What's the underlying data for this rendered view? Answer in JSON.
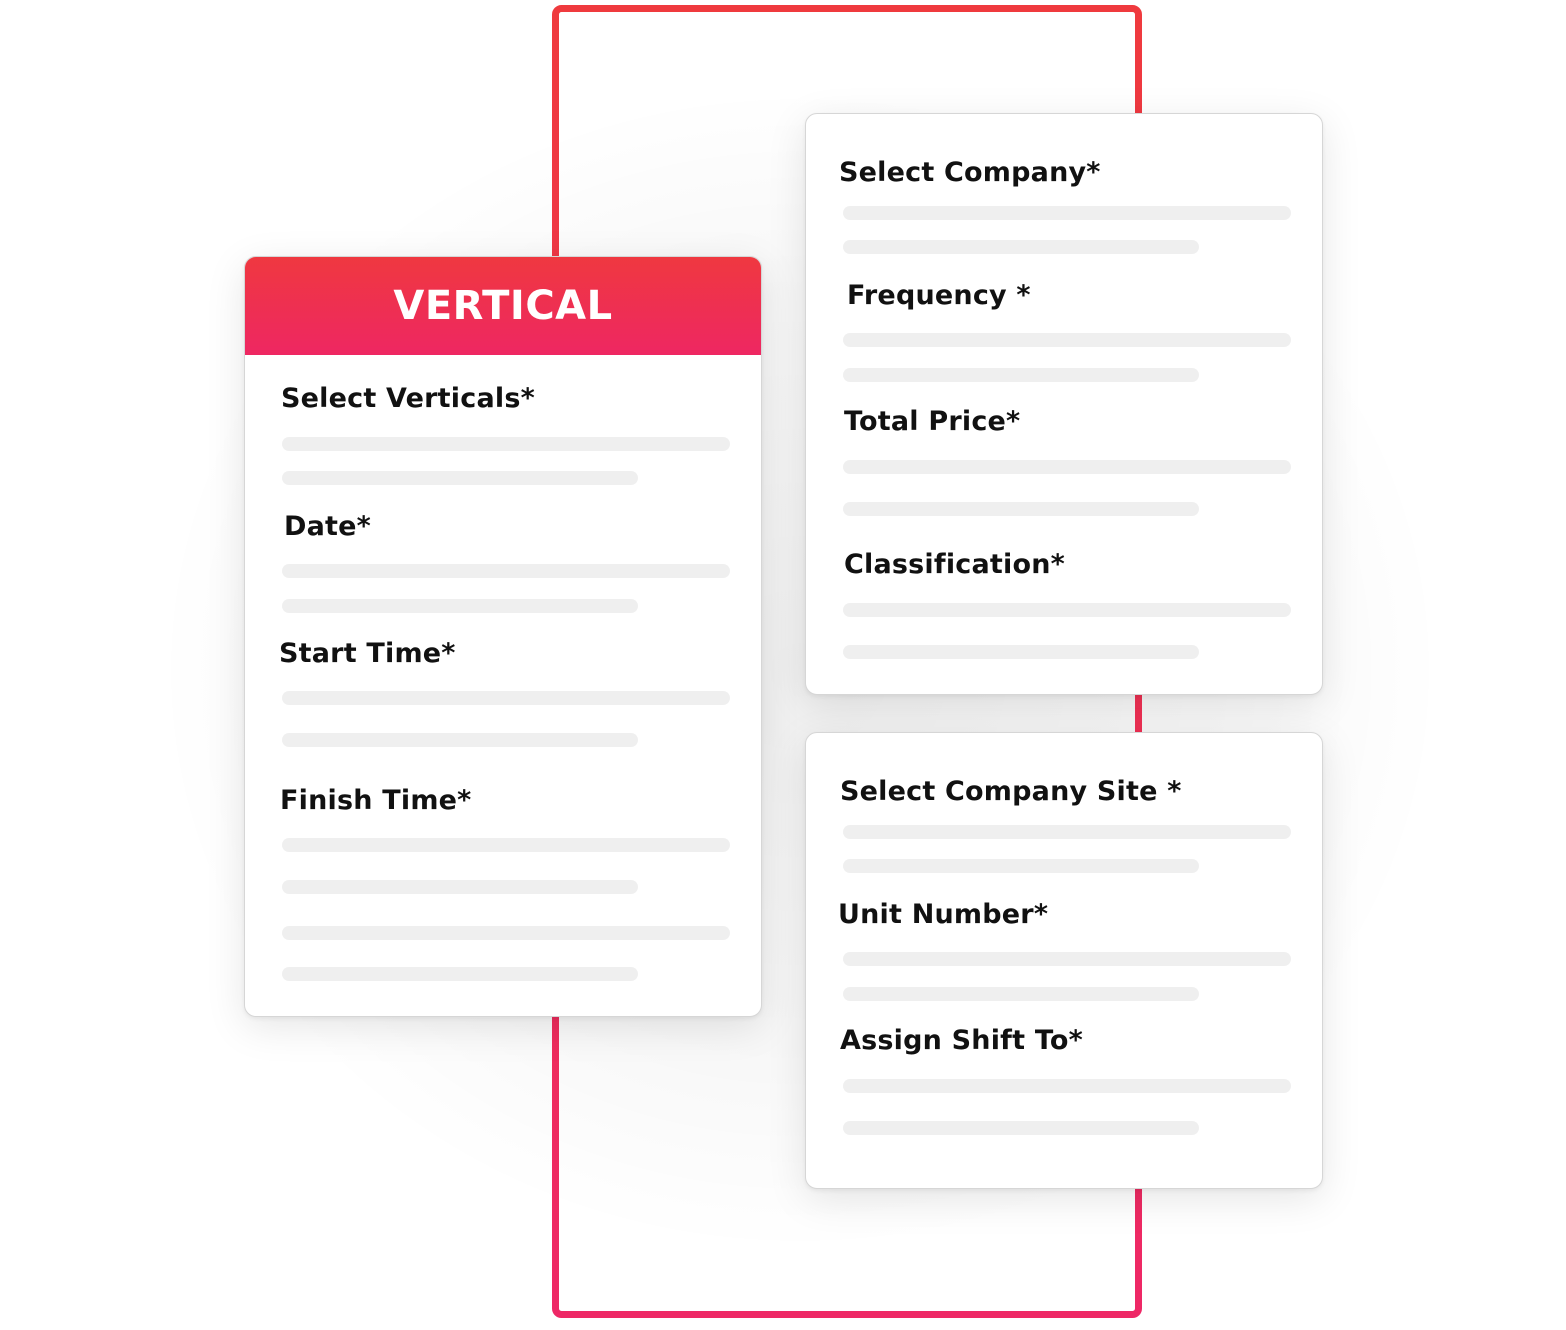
{
  "colors": {
    "accent_top": "#ef3840",
    "accent_bottom": "#ee2762",
    "skeleton": "#efefef",
    "label": "#111111",
    "card_bg": "#ffffff"
  },
  "left_card": {
    "title": "VERTICAL",
    "fields": [
      {
        "label": "Select Verticals*",
        "placeholder_lines": 2
      },
      {
        "label": "Date*",
        "placeholder_lines": 2
      },
      {
        "label": "Start Time*",
        "placeholder_lines": 2
      },
      {
        "label": "Finish Time*",
        "placeholder_lines": 4
      }
    ]
  },
  "right_card_top": {
    "fields": [
      {
        "label": "Select Company*",
        "placeholder_lines": 2
      },
      {
        "label": "Frequency *",
        "placeholder_lines": 2
      },
      {
        "label": "Total Price*",
        "placeholder_lines": 2
      },
      {
        "label": "Classification*",
        "placeholder_lines": 2
      }
    ]
  },
  "right_card_bottom": {
    "fields": [
      {
        "label": "Select Company Site *",
        "placeholder_lines": 2
      },
      {
        "label": "Unit Number*",
        "placeholder_lines": 2
      },
      {
        "label": "Assign Shift To*",
        "placeholder_lines": 2
      }
    ]
  }
}
